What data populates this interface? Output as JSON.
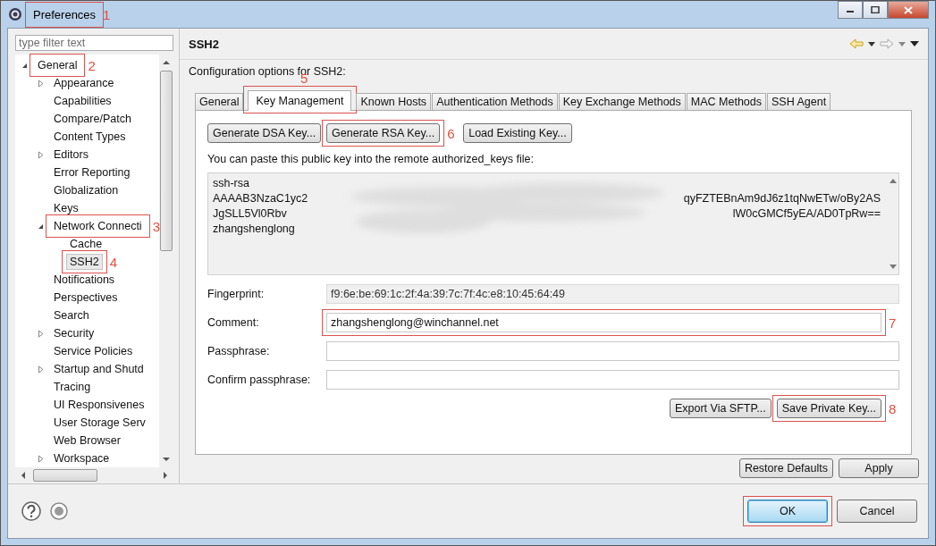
{
  "window": {
    "title": "Preferences",
    "callout": {
      "number": "1"
    }
  },
  "filter": {
    "placeholder": "type filter text"
  },
  "tree": [
    {
      "label": "General",
      "expanded": true,
      "selected": false,
      "callout": {
        "number": "2"
      },
      "children": [
        {
          "label": "Appearance",
          "expanded": false,
          "selected": false
        },
        {
          "label": "Capabilities",
          "selected": false
        },
        {
          "label": "Compare/Patch",
          "selected": false
        },
        {
          "label": "Content Types",
          "selected": false
        },
        {
          "label": "Editors",
          "expanded": false,
          "selected": false
        },
        {
          "label": "Error Reporting",
          "selected": false
        },
        {
          "label": "Globalization",
          "selected": false
        },
        {
          "label": "Keys",
          "selected": false
        },
        {
          "label": "Network Connecti",
          "expanded": true,
          "selected": false,
          "callout": {
            "number": "3"
          },
          "children": [
            {
              "label": "Cache",
              "selected": false
            },
            {
              "label": "SSH2",
              "selected": true,
              "callout": {
                "number": "4"
              }
            }
          ]
        },
        {
          "label": "Notifications",
          "selected": false
        },
        {
          "label": "Perspectives",
          "selected": false
        },
        {
          "label": "Search",
          "selected": false
        },
        {
          "label": "Security",
          "expanded": false,
          "selected": false
        },
        {
          "label": "Service Policies",
          "selected": false
        },
        {
          "label": "Startup and Shutd",
          "expanded": false,
          "selected": false
        },
        {
          "label": "Tracing",
          "selected": false
        },
        {
          "label": "UI Responsivenes",
          "selected": false
        },
        {
          "label": "User Storage Serv",
          "selected": false
        },
        {
          "label": "Web Browser",
          "selected": false
        },
        {
          "label": "Workspace",
          "expanded": false,
          "selected": false
        }
      ]
    }
  ],
  "page": {
    "title": "SSH2",
    "description": "Configuration options for SSH2:"
  },
  "tabs": [
    {
      "label": "General",
      "selected": false
    },
    {
      "label": "Key Management",
      "selected": true,
      "callout": {
        "number": "5"
      }
    },
    {
      "label": "Known Hosts",
      "selected": false
    },
    {
      "label": "Authentication Methods",
      "selected": false
    },
    {
      "label": "Key Exchange Methods",
      "selected": false
    },
    {
      "label": "MAC Methods",
      "selected": false
    },
    {
      "label": "SSH Agent",
      "selected": false
    }
  ],
  "key_buttons": [
    {
      "label": "Generate DSA Key..."
    },
    {
      "label": "Generate RSA Key...",
      "callout": {
        "number": "6"
      }
    },
    {
      "label": "Load Existing Key..."
    }
  ],
  "public_key": {
    "hint": "You can paste this public key into the remote authorized_keys file:",
    "lines": [
      {
        "start": "ssh-rsa"
      },
      {
        "start": "AAAAB3NzaC1yc2",
        "end": "qyFZTEBnAm9dJ6z1tqNwETw/oBy2AS"
      },
      {
        "start": "JgSLL5Vl0Rbv",
        "end": "lW0cGMCf5yEA/AD0TpRw=="
      },
      {
        "start": "zhangshenglong"
      }
    ]
  },
  "fields": [
    {
      "label": "Fingerprint:",
      "value": "f9:6e:be:69:1c:2f:4a:39:7c:7f:4c:e8:10:45:64:49",
      "disabled": true
    },
    {
      "label": "Comment:",
      "value": "zhangshenglong@winchannel.net",
      "disabled": false,
      "callout": {
        "number": "7"
      }
    },
    {
      "label": "Passphrase:",
      "disabled": false
    },
    {
      "label": "Confirm passphrase:",
      "disabled": false
    }
  ],
  "key_actions": [
    {
      "label": "Export Via SFTP..."
    },
    {
      "label": "Save Private Key...",
      "callout": {
        "number": "8"
      }
    }
  ],
  "page_buttons": [
    {
      "label": "Restore Defaults"
    },
    {
      "label": "Apply"
    }
  ],
  "dialog_buttons": [
    {
      "label": "OK",
      "default": true,
      "outlined": true
    },
    {
      "label": "Cancel",
      "default": false
    }
  ]
}
